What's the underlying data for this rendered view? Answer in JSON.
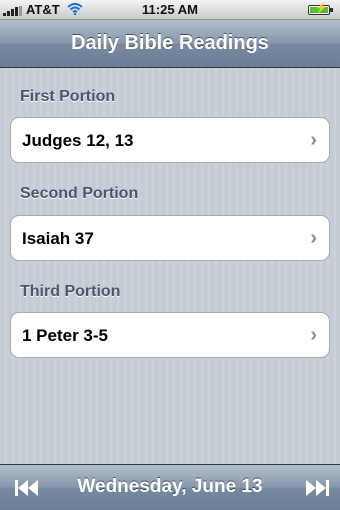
{
  "status_bar": {
    "carrier": "AT&T",
    "time": "11:25 AM",
    "battery_state": "charging",
    "icons": [
      "signal-icon",
      "wifi-icon",
      "battery-icon"
    ]
  },
  "nav_bar": {
    "title": "Daily Bible Readings"
  },
  "sections": [
    {
      "header": "First Portion",
      "reading": "Judges 12, 13"
    },
    {
      "header": "Second Portion",
      "reading": "Isaiah 37"
    },
    {
      "header": "Third Portion",
      "reading": "1 Peter 3-5"
    }
  ],
  "toolbar": {
    "date": "Wednesday, June 13",
    "prev_icon": "rewind-icon",
    "next_icon": "fast-forward-icon"
  },
  "colors": {
    "bar_gradient_top": "#b3bfcc",
    "bar_gradient_bottom": "#6b7f97",
    "section_header": "#4c566c",
    "background": "#c5ccd4",
    "chevron": "#8c8c8c",
    "battery_fill": "#4cc52e"
  }
}
